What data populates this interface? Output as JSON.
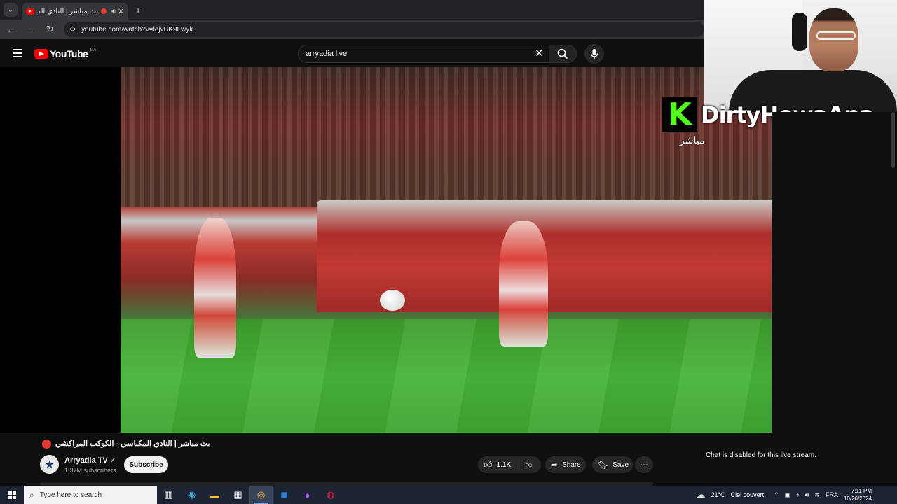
{
  "browser": {
    "tab": {
      "title": "بث مباشر | النادي المكنا...",
      "close_glyph": "✕"
    },
    "new_tab_glyph": "+",
    "tab_list_glyph": "⌄",
    "url": "youtube.com/watch?v=lejvBK9Lwyk"
  },
  "youtube": {
    "logo_text": "YouTube",
    "country_code": "MA",
    "search_value": "arryadia live",
    "search_clear_glyph": "✕"
  },
  "overlay": {
    "kick_letter": "K",
    "channel": "DirtyHowaAna",
    "live_text": "مباشر"
  },
  "video": {
    "title": "بث مباشر | النادي المكناسي - الكوكب المراكشي",
    "channel_name": "Arryadia TV",
    "subscribers": "1.37M subscribers",
    "subscribe_label": "Subscribe",
    "likes": "1.1K",
    "share_label": "Share",
    "save_label": "Save",
    "more_glyph": "⋯"
  },
  "chat": {
    "disabled_text": "Chat is disabled for this live stream."
  },
  "taskbar": {
    "search_placeholder": "Type here to search",
    "weather_temp": "21°C",
    "weather_desc": "Ciel couvert",
    "language": "FRA",
    "time": "7:11 PM",
    "date": "10/26/2024"
  },
  "colors": {
    "youtube_red": "#ff0000",
    "kick_green": "#53fc18",
    "live_red": "#e53935"
  }
}
